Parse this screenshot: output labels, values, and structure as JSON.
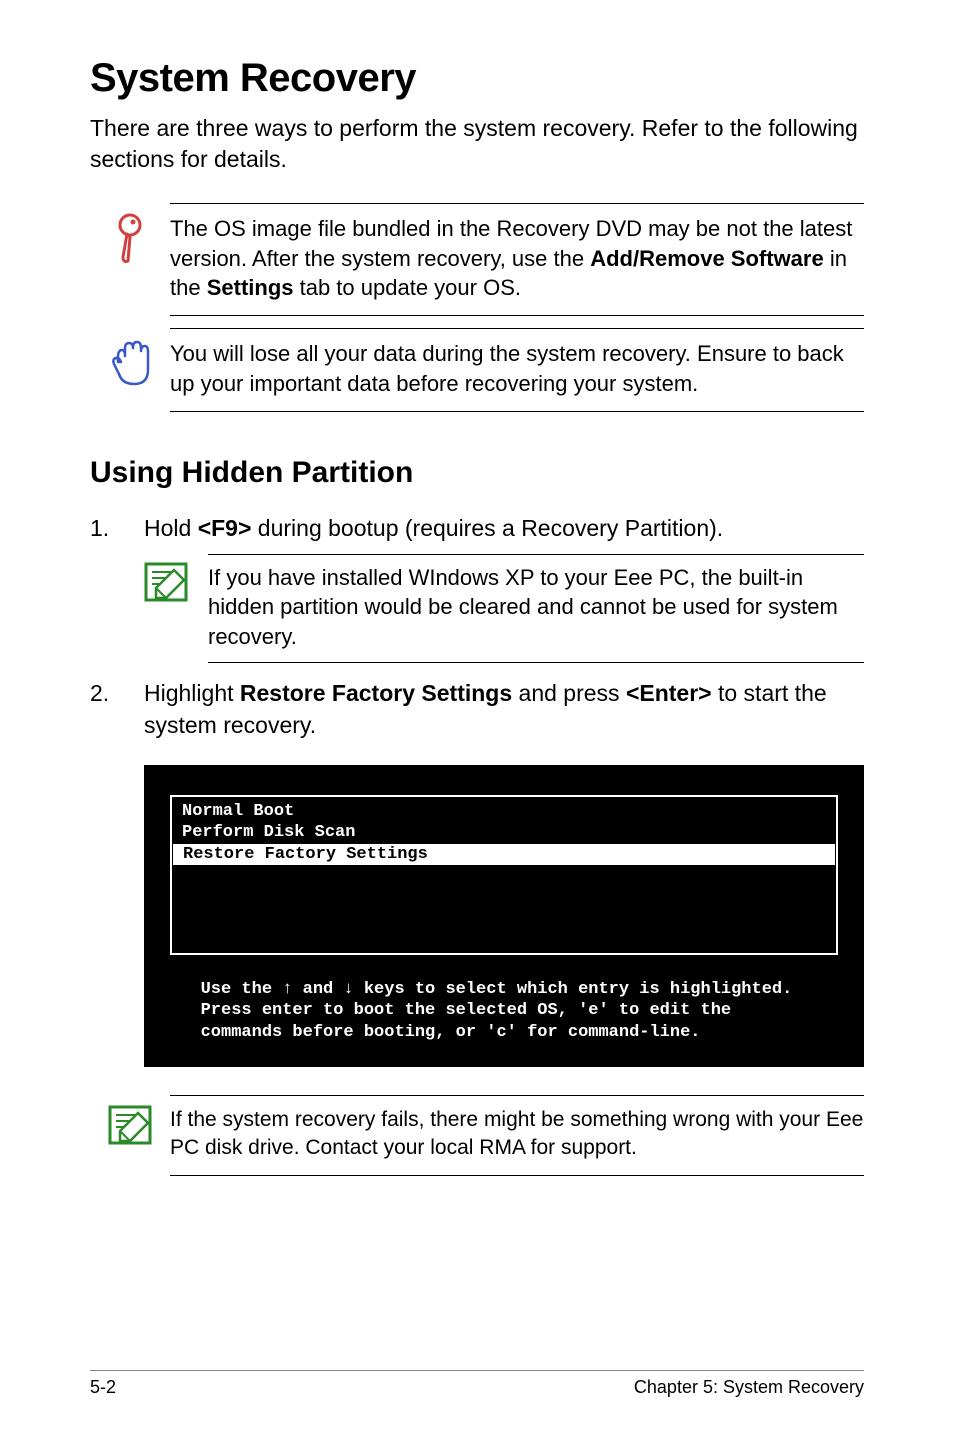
{
  "title": "System Recovery",
  "intro": "There are three ways to perform the system recovery. Refer to the following sections for details.",
  "callout1_pre": "The OS image file bundled in the Recovery DVD may be not the latest version. After the system recovery, use the ",
  "callout1_b1": "Add/Remove Software",
  "callout1_mid": " in the ",
  "callout1_b2": "Settings",
  "callout1_post": " tab to update your OS.",
  "callout2": "You will lose all your data during the system recovery. Ensure to back up your important data before recovering your system.",
  "h2": "Using Hidden Partition",
  "step1_num": "1.",
  "step1_pre": "Hold ",
  "step1_b": "<F9>",
  "step1_post": " during bootup (requires a Recovery Partition).",
  "nested1": "If you have installed WIndows XP to your Eee PC, the built-in hidden partition would be cleared and cannot be used for system recovery.",
  "step2_num": "2.",
  "step2_pre": "Highlight ",
  "step2_b1": "Restore Factory Settings",
  "step2_mid": " and press ",
  "step2_b2": "<Enter>",
  "step2_post": " to start the system recovery.",
  "terminal": {
    "menu": [
      {
        "text": "Normal Boot",
        "selected": false
      },
      {
        "text": "Perform Disk Scan",
        "selected": false
      },
      {
        "text": "Restore Factory Settings",
        "selected": true
      }
    ],
    "help1": "Use the ↑ and ↓ keys to select which entry is highlighted.",
    "help2": "Press enter to boot the selected OS, 'e' to edit the",
    "help3": "commands before booting, or 'c' for command-line."
  },
  "callout3": "If the system recovery fails, there might be something wrong with your Eee PC disk drive. Contact your local RMA for support.",
  "footer_left": "5-2",
  "footer_right": "Chapter 5: System Recovery"
}
